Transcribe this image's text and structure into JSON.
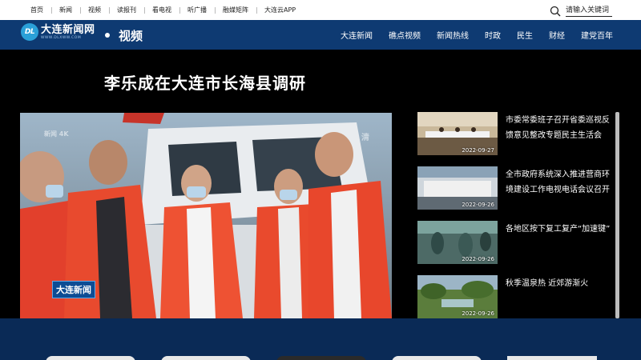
{
  "topnav": [
    "首页",
    "新闻",
    "视频",
    "读报刊",
    "看电视",
    "听广播",
    "融媒矩阵",
    "大连云APP"
  ],
  "search": {
    "placeholder": "请输入关键词",
    "icon": "search-icon"
  },
  "logo": {
    "mark": "DL",
    "name": "大连新闻网",
    "url": "WWW.DLXWW.COM"
  },
  "section": {
    "title": "视频"
  },
  "mainnav": [
    "大连新闻",
    "礁点视频",
    "新闻热线",
    "时政",
    "民生",
    "财经",
    "建党百年"
  ],
  "headline": "李乐成在大连市长海县调研",
  "video": {
    "watermark_left": "新闻 4K",
    "watermark_right": "清",
    "logo_text": "大连新闻"
  },
  "items": [
    {
      "title": "市委常委班子召开省委巡视反馈意见整改专题民主生活会",
      "date": "2022-09-27"
    },
    {
      "title": "全市政府系统深入推进营商环境建设工作电视电话会议召开",
      "date": "2022-09-26"
    },
    {
      "title": "各地区按下复工复产“加速键”",
      "date": "2022-09-26"
    },
    {
      "title": "秋季温泉热 近郊游渐火",
      "date": "2022-09-26"
    }
  ],
  "colors": {
    "header_bg": "#0e3a72",
    "content_bg": "#000000",
    "bottom_bg": "#0a2a56"
  }
}
